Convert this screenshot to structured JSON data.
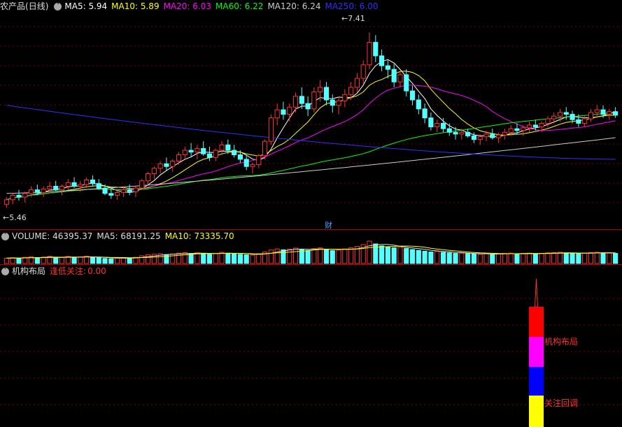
{
  "price_panel": {
    "stock_name": "农产品",
    "period": "(日线)",
    "ma_legend": [
      {
        "label": "MA5:",
        "value": "5.94",
        "color": "#ffffff"
      },
      {
        "label": "MA10:",
        "value": "5.89",
        "color": "#ffff00"
      },
      {
        "label": "MA20:",
        "value": "6.03",
        "color": "#ff00ff"
      },
      {
        "label": "MA60:",
        "value": "6.22",
        "color": "#00ff00"
      },
      {
        "label": "MA120:",
        "value": "6.24",
        "color": "#cccccc"
      },
      {
        "label": "MA250:",
        "value": "6.00",
        "color": "#2f2fff"
      }
    ],
    "high_marker": "7.41",
    "low_marker": "5.46",
    "finance_tag": "财"
  },
  "volume_panel": {
    "legend": [
      {
        "label": "VOLUME:",
        "value": "46395.37",
        "color": "#dddddd"
      },
      {
        "label": "MA5:",
        "value": "68191.25",
        "color": "#dddddd"
      },
      {
        "label": "MA10:",
        "value": "73335.70",
        "color": "#ffff00"
      }
    ]
  },
  "indicator_panel": {
    "title": "机构布局",
    "legend_label": "逢低关注:",
    "legend_value": "0.00",
    "label_upper": "机构布局",
    "label_lower": "关注回调"
  },
  "colors": {
    "up": "#ff3232",
    "down": "#54ffff",
    "grid": "#7a0000",
    "separator": "#b00000"
  },
  "chart_data": [
    {
      "type": "candlestick",
      "title": "农产品(日线)",
      "ylim": [
        5.3,
        7.6
      ],
      "ohlc": [
        [
          5.5,
          5.58,
          5.46,
          5.55
        ],
        [
          5.55,
          5.62,
          5.5,
          5.6
        ],
        [
          5.6,
          5.66,
          5.54,
          5.58
        ],
        [
          5.58,
          5.64,
          5.52,
          5.62
        ],
        [
          5.62,
          5.7,
          5.58,
          5.66
        ],
        [
          5.66,
          5.72,
          5.6,
          5.63
        ],
        [
          5.63,
          5.7,
          5.58,
          5.67
        ],
        [
          5.67,
          5.75,
          5.62,
          5.7
        ],
        [
          5.7,
          5.76,
          5.64,
          5.66
        ],
        [
          5.66,
          5.72,
          5.6,
          5.7
        ],
        [
          5.7,
          5.78,
          5.66,
          5.74
        ],
        [
          5.74,
          5.8,
          5.68,
          5.7
        ],
        [
          5.7,
          5.76,
          5.64,
          5.72
        ],
        [
          5.72,
          5.8,
          5.68,
          5.77
        ],
        [
          5.77,
          5.82,
          5.7,
          5.73
        ],
        [
          5.73,
          5.78,
          5.66,
          5.68
        ],
        [
          5.68,
          5.72,
          5.6,
          5.62
        ],
        [
          5.62,
          5.68,
          5.56,
          5.6
        ],
        [
          5.6,
          5.66,
          5.55,
          5.63
        ],
        [
          5.63,
          5.7,
          5.58,
          5.66
        ],
        [
          5.66,
          5.72,
          5.6,
          5.64
        ],
        [
          5.64,
          5.7,
          5.58,
          5.68
        ],
        [
          5.68,
          5.78,
          5.66,
          5.76
        ],
        [
          5.76,
          5.86,
          5.72,
          5.84
        ],
        [
          5.84,
          5.92,
          5.78,
          5.9
        ],
        [
          5.9,
          5.98,
          5.84,
          5.95
        ],
        [
          5.95,
          6.02,
          5.88,
          5.92
        ],
        [
          5.92,
          6.0,
          5.86,
          5.98
        ],
        [
          5.98,
          6.08,
          5.94,
          6.05
        ],
        [
          6.05,
          6.14,
          6.0,
          6.1
        ],
        [
          6.1,
          6.18,
          6.02,
          6.08
        ],
        [
          6.08,
          6.16,
          6.0,
          6.12
        ],
        [
          6.12,
          6.2,
          6.04,
          6.06
        ],
        [
          6.06,
          6.14,
          5.98,
          6.02
        ],
        [
          6.02,
          6.12,
          5.98,
          6.1
        ],
        [
          6.1,
          6.2,
          6.06,
          6.16
        ],
        [
          6.16,
          6.22,
          6.06,
          6.1
        ],
        [
          6.1,
          6.16,
          6.02,
          6.05
        ],
        [
          6.05,
          6.1,
          5.96,
          6.0
        ],
        [
          6.0,
          6.04,
          5.88,
          5.92
        ],
        [
          5.92,
          5.96,
          5.84,
          5.94
        ],
        [
          5.94,
          6.06,
          5.9,
          6.04
        ],
        [
          6.04,
          6.22,
          6.0,
          6.2
        ],
        [
          6.2,
          6.5,
          6.16,
          6.46
        ],
        [
          6.46,
          6.62,
          6.38,
          6.55
        ],
        [
          6.55,
          6.64,
          6.44,
          6.5
        ],
        [
          6.5,
          6.62,
          6.42,
          6.58
        ],
        [
          6.58,
          6.74,
          6.52,
          6.7
        ],
        [
          6.7,
          6.8,
          6.56,
          6.62
        ],
        [
          6.62,
          6.7,
          6.48,
          6.56
        ],
        [
          6.56,
          6.8,
          6.52,
          6.75
        ],
        [
          6.75,
          6.88,
          6.64,
          6.8
        ],
        [
          6.8,
          6.86,
          6.6,
          6.66
        ],
        [
          6.66,
          6.72,
          6.52,
          6.6
        ],
        [
          6.6,
          6.7,
          6.5,
          6.65
        ],
        [
          6.65,
          6.78,
          6.58,
          6.72
        ],
        [
          6.72,
          6.86,
          6.66,
          6.8
        ],
        [
          6.8,
          6.96,
          6.74,
          6.9
        ],
        [
          6.9,
          7.1,
          6.84,
          7.05
        ],
        [
          7.05,
          7.41,
          7.0,
          7.3
        ],
        [
          7.3,
          7.38,
          7.08,
          7.15
        ],
        [
          7.15,
          7.22,
          6.98,
          7.04
        ],
        [
          7.04,
          7.1,
          6.9,
          7.0
        ],
        [
          7.0,
          7.06,
          6.8,
          6.86
        ],
        [
          6.86,
          6.98,
          6.8,
          6.94
        ],
        [
          6.94,
          7.0,
          6.7,
          6.76
        ],
        [
          6.76,
          6.82,
          6.6,
          6.66
        ],
        [
          6.66,
          6.72,
          6.5,
          6.56
        ],
        [
          6.56,
          6.62,
          6.4,
          6.46
        ],
        [
          6.46,
          6.52,
          6.32,
          6.36
        ],
        [
          6.36,
          6.44,
          6.3,
          6.4
        ],
        [
          6.4,
          6.46,
          6.3,
          6.34
        ],
        [
          6.34,
          6.4,
          6.26,
          6.3
        ],
        [
          6.3,
          6.36,
          6.22,
          6.28
        ],
        [
          6.28,
          6.34,
          6.22,
          6.3
        ],
        [
          6.3,
          6.34,
          6.24,
          6.26
        ],
        [
          6.26,
          6.3,
          6.18,
          6.22
        ],
        [
          6.22,
          6.28,
          6.16,
          6.25
        ],
        [
          6.25,
          6.32,
          6.2,
          6.28
        ],
        [
          6.28,
          6.34,
          6.22,
          6.24
        ],
        [
          6.24,
          6.3,
          6.18,
          6.27
        ],
        [
          6.27,
          6.34,
          6.22,
          6.3
        ],
        [
          6.3,
          6.38,
          6.26,
          6.34
        ],
        [
          6.34,
          6.4,
          6.28,
          6.32
        ],
        [
          6.32,
          6.38,
          6.26,
          6.35
        ],
        [
          6.35,
          6.42,
          6.3,
          6.38
        ],
        [
          6.38,
          6.44,
          6.32,
          6.36
        ],
        [
          6.36,
          6.42,
          6.3,
          6.4
        ],
        [
          6.4,
          6.48,
          6.36,
          6.45
        ],
        [
          6.45,
          6.52,
          6.4,
          6.48
        ],
        [
          6.48,
          6.56,
          6.42,
          6.52
        ],
        [
          6.52,
          6.58,
          6.44,
          6.5
        ],
        [
          6.5,
          6.54,
          6.4,
          6.44
        ],
        [
          6.44,
          6.5,
          6.36,
          6.4
        ],
        [
          6.4,
          6.48,
          6.36,
          6.45
        ],
        [
          6.45,
          6.56,
          6.42,
          6.52
        ],
        [
          6.52,
          6.6,
          6.46,
          6.55
        ],
        [
          6.55,
          6.6,
          6.46,
          6.5
        ],
        [
          6.5,
          6.56,
          6.44,
          6.53
        ],
        [
          6.53,
          6.58,
          6.46,
          6.49
        ]
      ],
      "moving_averages": [
        "MA5",
        "MA10",
        "MA20",
        "MA60",
        "MA120",
        "MA250"
      ]
    },
    {
      "type": "bar",
      "title": "VOLUME",
      "values": [
        38,
        41,
        36,
        44,
        48,
        42,
        46,
        51,
        40,
        45,
        50,
        43,
        47,
        52,
        44,
        40,
        36,
        34,
        38,
        42,
        39,
        44,
        55,
        62,
        66,
        70,
        64,
        68,
        74,
        78,
        72,
        76,
        70,
        66,
        72,
        80,
        74,
        70,
        66,
        62,
        60,
        68,
        82,
        96,
        104,
        98,
        102,
        110,
        100,
        94,
        106,
        112,
        100,
        92,
        96,
        104,
        112,
        122,
        135,
        160,
        140,
        126,
        118,
        112,
        116,
        108,
        100,
        94,
        88,
        82,
        86,
        80,
        76,
        72,
        74,
        70,
        68,
        66,
        70,
        66,
        68,
        72,
        74,
        70,
        72,
        74,
        70,
        72,
        76,
        78,
        80,
        76,
        72,
        70,
        74,
        78,
        80,
        76,
        74,
        72
      ],
      "ylim": [
        0,
        170
      ]
    }
  ]
}
